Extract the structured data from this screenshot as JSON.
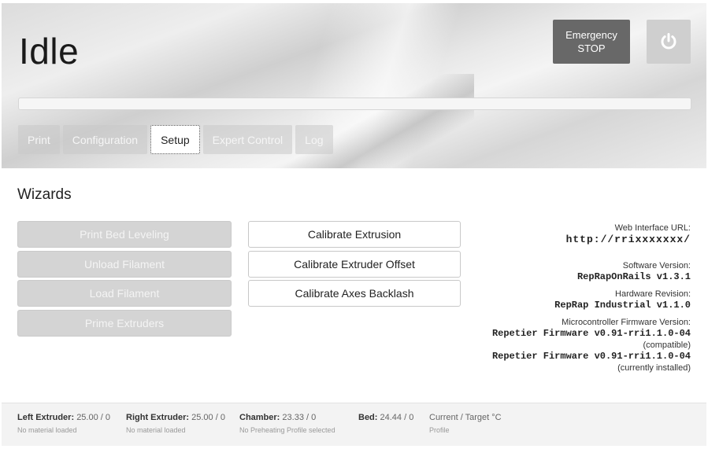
{
  "header": {
    "status_title": "Idle",
    "emergency_stop": {
      "line1": "Emergency",
      "line2": "STOP"
    },
    "power_icon": "power-icon",
    "progress": 0
  },
  "tabs": [
    {
      "label": "Print",
      "active": false
    },
    {
      "label": "Configuration",
      "active": false
    },
    {
      "label": "Setup",
      "active": true
    },
    {
      "label": "Expert Control",
      "active": false
    },
    {
      "label": "Log",
      "active": false
    }
  ],
  "wizards": {
    "title": "Wizards",
    "left_buttons": [
      {
        "label": "Print Bed Leveling",
        "enabled": false
      },
      {
        "label": "Unload Filament",
        "enabled": false
      },
      {
        "label": "Load Filament",
        "enabled": false
      },
      {
        "label": "Prime Extruders",
        "enabled": false
      }
    ],
    "middle_buttons": [
      {
        "label": "Calibrate Extrusion",
        "enabled": true
      },
      {
        "label": "Calibrate Extruder Offset",
        "enabled": true
      },
      {
        "label": "Calibrate Axes Backlash",
        "enabled": true
      }
    ]
  },
  "info": {
    "web_url_label": "Web Interface URL:",
    "web_url_value": "http://rrixxxxxxx/",
    "software_label": "Software Version:",
    "software_value": "RepRapOnRails v1.3.1",
    "hardware_label": "Hardware Revision:",
    "hardware_value": "RepRap Industrial v1.1.0",
    "firmware_label": "Microcontroller Firmware Version:",
    "firmware_compatible_value": "Repetier Firmware v0.91-rri1.1.0-04",
    "firmware_compatible_note": "(compatible)",
    "firmware_installed_value": "Repetier Firmware v0.91-rri1.1.0-04",
    "firmware_installed_note": "(currently installed)"
  },
  "footer": {
    "left_extruder": {
      "label": "Left Extruder:",
      "value": "25.00 / 0",
      "sub": "No material loaded"
    },
    "right_extruder": {
      "label": "Right Extruder:",
      "value": "25.00 / 0",
      "sub": "No material loaded"
    },
    "chamber": {
      "label": "Chamber:",
      "value": "23.33 / 0",
      "sub": "No Preheating Profile selected"
    },
    "bed": {
      "label": "Bed:",
      "value": "24.44 / 0"
    },
    "legend": {
      "main": "Current / Target °C",
      "sub": "Profile"
    }
  }
}
